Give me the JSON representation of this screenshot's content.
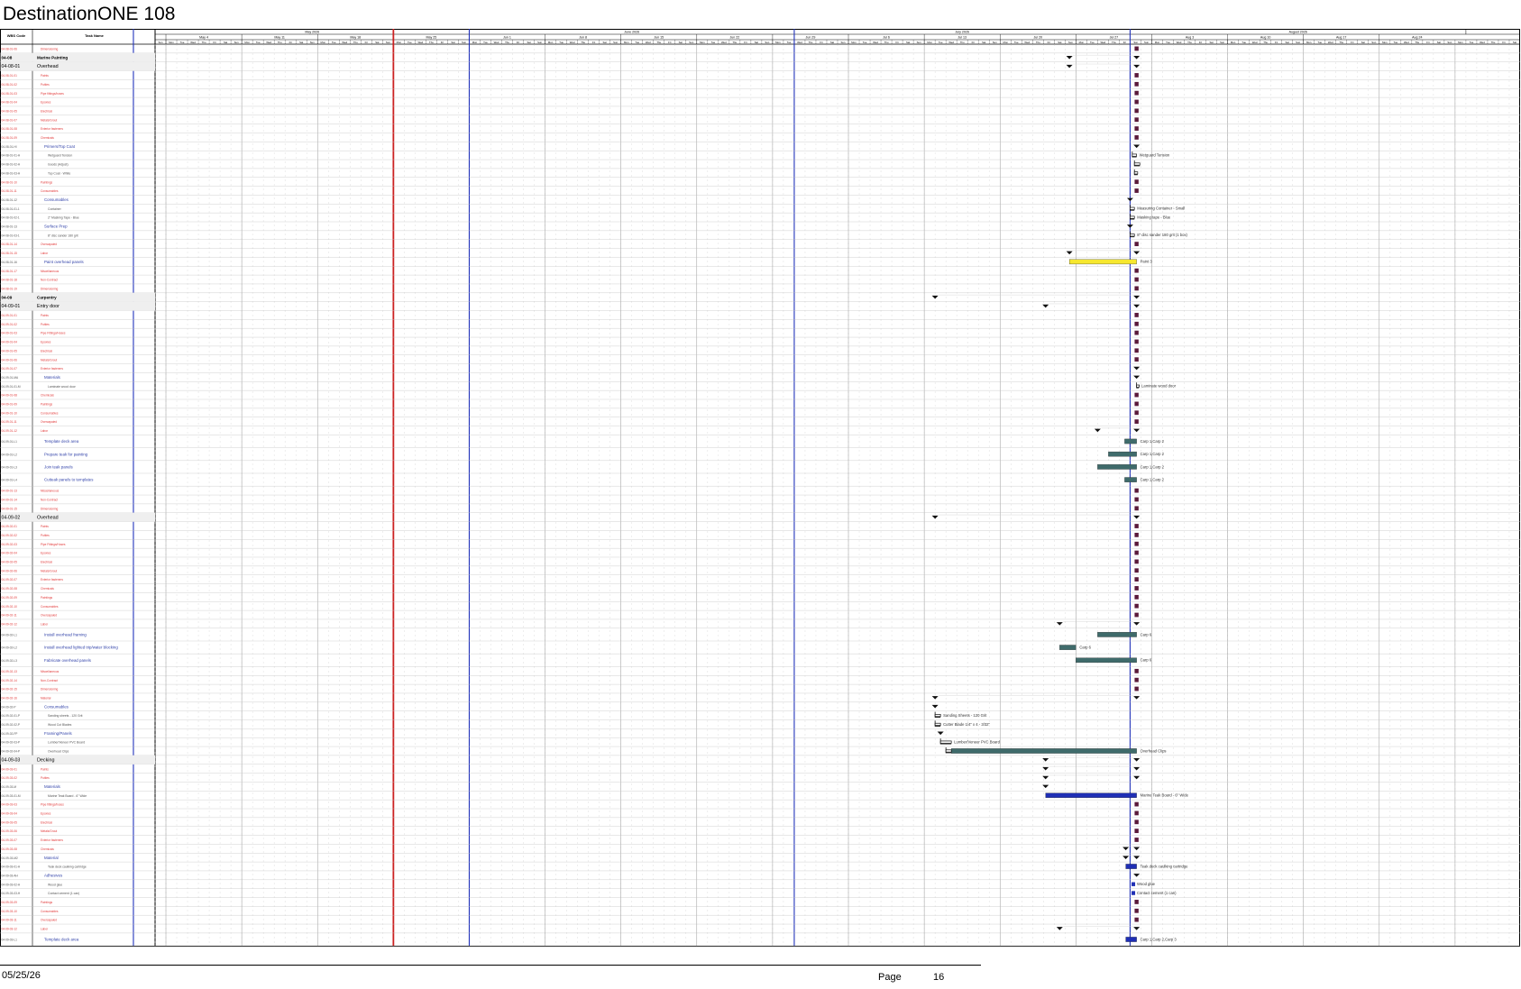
{
  "document": {
    "title": "DestinationONE 108"
  },
  "columns": {
    "wbs": "WBS Code",
    "task": "Task Name"
  },
  "months": [
    {
      "label": "May 2026",
      "start": 0,
      "days": 31
    },
    {
      "label": "June 2026",
      "start": 31,
      "days": 30
    },
    {
      "label": "July 2026",
      "start": 61,
      "days": 31
    },
    {
      "label": "August 2026",
      "start": 92,
      "days": 31
    }
  ],
  "weeks": [
    "May 4",
    "May 11",
    "May 18",
    "May 25",
    "Jun 1",
    "Jun 8",
    "Jun 15",
    "Jun 22",
    "Jun 29",
    "Jul 6",
    "Jul 13",
    "Jul 20",
    "Jul 27",
    "Aug 3",
    "Aug 10",
    "Aug 17",
    "Aug 24"
  ],
  "weekdays": [
    "Mon",
    "Tue",
    "Wed",
    "Thu",
    "Fri",
    "Sat",
    "Sun"
  ],
  "today_marker": "May 25",
  "rows": [
    {
      "wbs": "04-08-01-06",
      "name": "Dimensioning",
      "type": "res",
      "indent": 1,
      "ms": [
        92.6
      ]
    },
    {
      "wbs": "04-08",
      "name": "Marine Painting",
      "type": "phase",
      "indent": 0,
      "tri": [
        86.4,
        92.6
      ]
    },
    {
      "wbs": "04-08-01",
      "name": "Overhead",
      "type": "group",
      "indent": 0,
      "tri": [
        86.4,
        92.6
      ]
    },
    {
      "wbs": "04-08-01-01",
      "name": "Paints",
      "type": "res",
      "indent": 1,
      "ms": [
        92.6
      ]
    },
    {
      "wbs": "04-08-01-02",
      "name": "Putties",
      "type": "res",
      "indent": 1,
      "ms": [
        92.6
      ]
    },
    {
      "wbs": "04-08-01-03",
      "name": "Pipe fittings/hoses",
      "type": "res",
      "indent": 1,
      "ms": [
        92.6
      ]
    },
    {
      "wbs": "04-08-01-04",
      "name": "Epoxies",
      "type": "res",
      "indent": 1,
      "ms": [
        92.6
      ]
    },
    {
      "wbs": "04-08-01-05",
      "name": "Electrical",
      "type": "res",
      "indent": 1,
      "ms": [
        92.6
      ]
    },
    {
      "wbs": "04-08-01-07",
      "name": "Metals/Grout",
      "type": "res",
      "indent": 1,
      "ms": [
        92.6
      ]
    },
    {
      "wbs": "04-08-01-08",
      "name": "Exterior fasteners",
      "type": "res",
      "indent": 1,
      "ms": [
        92.6
      ]
    },
    {
      "wbs": "04-08-01-09",
      "name": "Chemicals",
      "type": "res",
      "indent": 1,
      "ms": [
        92.6
      ]
    },
    {
      "wbs": "04-08-01-HI",
      "name": "Primers/Top Coat",
      "type": "sub",
      "indent": 2,
      "tri": [
        92.6
      ]
    },
    {
      "wbs": "04-08-01-01-H",
      "name": "Wetguard Tension",
      "type": "item",
      "indent": 3,
      "brk": [
        92.2,
        92.6
      ],
      "lbl": "Wetguard Tension"
    },
    {
      "wbs": "04-08-01-02-H",
      "name": "Goods (Adjust)",
      "type": "item",
      "indent": 3,
      "brk": [
        92.4,
        92.9
      ]
    },
    {
      "wbs": "04-08-01-03-H",
      "name": "Top Coat - White",
      "type": "item",
      "indent": 3,
      "brk": [
        92.4,
        92.7
      ]
    },
    {
      "wbs": "04-08-01-10",
      "name": "Paintings",
      "type": "res",
      "indent": 1,
      "ms": [
        92.6
      ]
    },
    {
      "wbs": "04-08-01-11",
      "name": "Consumables",
      "type": "res",
      "indent": 1,
      "ms": [
        92.6
      ]
    },
    {
      "wbs": "04-08-01-12",
      "name": "Consumables",
      "type": "sub",
      "indent": 2,
      "tri": [
        92.0
      ]
    },
    {
      "wbs": "04-08-01-01-1",
      "name": "Container",
      "type": "item",
      "indent": 3,
      "brk": [
        92.0,
        92.4
      ],
      "lbl": "Measuring Container - Small"
    },
    {
      "wbs": "04-08-01-02-1",
      "name": "2\" Masking Tape - Blue",
      "type": "item",
      "indent": 3,
      "brk": [
        92.0,
        92.4
      ],
      "lbl": "Masking tape - Blue"
    },
    {
      "wbs": "04-08-01-13",
      "name": "Surface Prep",
      "type": "sub",
      "indent": 2,
      "tri": [
        92.0
      ]
    },
    {
      "wbs": "04-08-01-03-1",
      "name": "8\" disc sander 180 grit",
      "type": "item",
      "indent": 3,
      "brk": [
        92.0,
        92.4
      ],
      "lbl": "8\" disc sander 180 grit (1 box)"
    },
    {
      "wbs": "04-08-01-14",
      "name": "Overcapaied",
      "type": "res",
      "indent": 1,
      "ms": [
        92.6
      ]
    },
    {
      "wbs": "04-08-01-15",
      "name": "Labor",
      "type": "res",
      "indent": 1,
      "tri": [
        86.4,
        92.6
      ]
    },
    {
      "wbs": "04-08-01-16",
      "name": "Paint overhead panels",
      "type": "task",
      "indent": 2,
      "bar": [
        86.4,
        92.6,
        "#f6e72f"
      ],
      "lbl": "Paint 3"
    },
    {
      "wbs": "04-08-01-17",
      "name": "Miscellaneous",
      "type": "res",
      "indent": 1,
      "ms": [
        92.6
      ]
    },
    {
      "wbs": "04-08-01-18",
      "name": "Non-Contract",
      "type": "res",
      "indent": 1,
      "ms": [
        92.6
      ]
    },
    {
      "wbs": "04-08-01-19",
      "name": "Dimensioning",
      "type": "res",
      "indent": 1,
      "ms": [
        92.6
      ]
    },
    {
      "wbs": "04-09",
      "name": "Carpentry",
      "type": "phase",
      "indent": 0,
      "tri": [
        74.0,
        92.6
      ]
    },
    {
      "wbs": "04-09-01",
      "name": "Entry door",
      "type": "group",
      "indent": 0,
      "tri": [
        84.2,
        92.6
      ]
    },
    {
      "wbs": "04-09-01-01",
      "name": "Paints",
      "type": "res",
      "indent": 1,
      "ms": [
        92.6
      ]
    },
    {
      "wbs": "04-09-01-02",
      "name": "Putties",
      "type": "res",
      "indent": 1,
      "ms": [
        92.6
      ]
    },
    {
      "wbs": "04-09-01-03",
      "name": "Pipe Fittings/Hoses",
      "type": "res",
      "indent": 1,
      "ms": [
        92.6
      ]
    },
    {
      "wbs": "04-09-01-04",
      "name": "Epoxies",
      "type": "res",
      "indent": 1,
      "ms": [
        92.6
      ]
    },
    {
      "wbs": "04-09-01-05",
      "name": "Electrical",
      "type": "res",
      "indent": 1,
      "ms": [
        92.6
      ]
    },
    {
      "wbs": "04-09-01-06",
      "name": "Metals/Grout",
      "type": "res",
      "indent": 1,
      "ms": [
        92.6
      ]
    },
    {
      "wbs": "04-09-01-07",
      "name": "Exterior fasteners",
      "type": "res",
      "indent": 1,
      "tri": [
        92.6
      ]
    },
    {
      "wbs": "04-09-01-MA",
      "name": "Materials",
      "type": "sub",
      "indent": 2,
      "tri": [
        92.6
      ]
    },
    {
      "wbs": "04-09-01-01-M",
      "name": "Laminate wood door",
      "type": "item",
      "indent": 3,
      "brk": [
        92.6,
        92.8
      ],
      "lbl": "Laminate wood door"
    },
    {
      "wbs": "04-09-01-08",
      "name": "Chemicals",
      "type": "res",
      "indent": 1,
      "ms": [
        92.6
      ]
    },
    {
      "wbs": "04-09-01-09",
      "name": "Paintings",
      "type": "res",
      "indent": 1,
      "ms": [
        92.6
      ]
    },
    {
      "wbs": "04-09-01-10",
      "name": "Consumables",
      "type": "res",
      "indent": 1,
      "ms": [
        92.6
      ]
    },
    {
      "wbs": "04-09-01-11",
      "name": "Overcapaied",
      "type": "res",
      "indent": 1,
      "ms": [
        92.6
      ]
    },
    {
      "wbs": "04-09-01-12",
      "name": "Labor",
      "type": "res",
      "indent": 1,
      "tri": [
        89.0,
        92.6
      ]
    },
    {
      "wbs": "04-09-01-L1",
      "name": "Template deck area",
      "type": "task",
      "indent": 2,
      "tall": true,
      "bar": [
        91.5,
        92.6,
        "#3f6b6b"
      ],
      "lbl": "Carp 1,Carp 2"
    },
    {
      "wbs": "04-09-01-L2",
      "name": "Prepare teak for painting",
      "type": "task",
      "indent": 2,
      "tall": true,
      "bar": [
        90.0,
        92.6,
        "#3f6b6b"
      ],
      "lbl": "Carp 1,Carp 2"
    },
    {
      "wbs": "04-09-01-L3",
      "name": "Join teak panels",
      "type": "task",
      "indent": 2,
      "tall": true,
      "bar": [
        89.0,
        92.6,
        "#3f6b6b"
      ],
      "lbl": "Carp 1,Carp 2"
    },
    {
      "wbs": "04-09-01-L4",
      "name": "Cutteak panels to templates",
      "type": "task",
      "indent": 2,
      "tall": true,
      "bar": [
        91.5,
        92.6,
        "#3f6b6b"
      ],
      "lbl": "Carp 1,Carp 2"
    },
    {
      "wbs": "04-09-01-13",
      "name": "Miscellaneous",
      "type": "res",
      "indent": 1,
      "ms": [
        92.6
      ]
    },
    {
      "wbs": "04-09-01-14",
      "name": "Non-Contract",
      "type": "res",
      "indent": 1,
      "ms": [
        92.6
      ]
    },
    {
      "wbs": "04-09-01-15",
      "name": "Dimensioning",
      "type": "res",
      "indent": 1,
      "ms": [
        92.6
      ]
    },
    {
      "wbs": "04-09-02",
      "name": "Overhead",
      "type": "group",
      "indent": 0,
      "tri": [
        74.0,
        92.6
      ]
    },
    {
      "wbs": "04-09-02-01",
      "name": "Paints",
      "type": "res",
      "indent": 1,
      "ms": [
        92.6
      ]
    },
    {
      "wbs": "04-09-02-02",
      "name": "Putties",
      "type": "res",
      "indent": 1,
      "ms": [
        92.6
      ]
    },
    {
      "wbs": "04-09-02-03",
      "name": "Pipe Fittings/Hoses",
      "type": "res",
      "indent": 1,
      "ms": [
        92.6
      ]
    },
    {
      "wbs": "04-09-02-04",
      "name": "Epoxies",
      "type": "res",
      "indent": 1,
      "ms": [
        92.6
      ]
    },
    {
      "wbs": "04-09-02-05",
      "name": "Electrical",
      "type": "res",
      "indent": 1,
      "ms": [
        92.6
      ]
    },
    {
      "wbs": "04-09-02-06",
      "name": "Metals/Grout",
      "type": "res",
      "indent": 1,
      "ms": [
        92.6
      ]
    },
    {
      "wbs": "04-09-02-07",
      "name": "Exterior fasteners",
      "type": "res",
      "indent": 1,
      "ms": [
        92.6
      ]
    },
    {
      "wbs": "04-09-02-08",
      "name": "Chemicals",
      "type": "res",
      "indent": 1,
      "ms": [
        92.6
      ]
    },
    {
      "wbs": "04-09-02-09",
      "name": "Paintings",
      "type": "res",
      "indent": 1,
      "ms": [
        92.6
      ]
    },
    {
      "wbs": "04-09-02-10",
      "name": "Consumables",
      "type": "res",
      "indent": 1,
      "ms": [
        92.6
      ]
    },
    {
      "wbs": "04-09-02-11",
      "name": "Overcapaied",
      "type": "res",
      "indent": 1,
      "ms": [
        92.6
      ]
    },
    {
      "wbs": "04-09-02-12",
      "name": "Labor",
      "type": "res",
      "indent": 1,
      "tri": [
        85.5,
        92.6
      ]
    },
    {
      "wbs": "04-09-02-L1",
      "name": "Install overhead framing",
      "type": "task",
      "indent": 2,
      "tall": true,
      "bar": [
        89.0,
        92.6,
        "#3f6b6b"
      ],
      "lbl": "Carp 6"
    },
    {
      "wbs": "04-09-02-L2",
      "name": "Install overhead lighted trip/water blocking",
      "type": "task",
      "indent": 2,
      "tall": true,
      "bar": [
        85.5,
        87.0,
        "#3f6b6b"
      ],
      "lbl": "Carp 6"
    },
    {
      "wbs": "04-09-02-L3",
      "name": "Fabricate overhead panels",
      "type": "task",
      "indent": 2,
      "tall": true,
      "bar": [
        87.0,
        92.6,
        "#3f6b6b"
      ],
      "lbl": "Carp 6"
    },
    {
      "wbs": "04-09-02-13",
      "name": "Miscellaneous",
      "type": "res",
      "indent": 1,
      "ms": [
        92.6
      ]
    },
    {
      "wbs": "04-09-02-14",
      "name": "Non-Contract",
      "type": "res",
      "indent": 1,
      "ms": [
        92.6
      ]
    },
    {
      "wbs": "04-09-02-15",
      "name": "Dimensioning",
      "type": "res",
      "indent": 1,
      "ms": [
        92.6
      ]
    },
    {
      "wbs": "04-09-02-16",
      "name": "Material",
      "type": "res",
      "indent": 1,
      "tri": [
        74.0,
        92.6
      ]
    },
    {
      "wbs": "04-09-02-P",
      "name": "Consumables",
      "type": "sub",
      "indent": 2,
      "tri": [
        74.0
      ]
    },
    {
      "wbs": "04-09-02-01-P",
      "name": "Sanding sheets - 120 Grit",
      "type": "item",
      "indent": 3,
      "brk": [
        74.0,
        74.5
      ],
      "lbl": "Sanding Sheets - 120 Grit"
    },
    {
      "wbs": "04-09-02-02-P",
      "name": "Wood Cut Blades",
      "type": "item",
      "indent": 3,
      "brk": [
        74.0,
        74.5
      ],
      "lbl": "Cutter Blade 1/4\" x 4 - 3/32\""
    },
    {
      "wbs": "04-09-02-FP",
      "name": "Framing/Panels",
      "type": "sub",
      "indent": 2,
      "tri": [
        74.5
      ]
    },
    {
      "wbs": "04-09-02-03-P",
      "name": "Lumber/Veneer PVC Board",
      "type": "item",
      "indent": 3,
      "brk": [
        74.5,
        75.5
      ],
      "lbl": "Lumber/Veneer PVC Board"
    },
    {
      "wbs": "04-09-02-04-P",
      "name": "Overhead Clips",
      "type": "item",
      "indent": 3,
      "bar": [
        75.5,
        92.6,
        "#3f6b6b"
      ],
      "brk": [
        75.0,
        75.5
      ],
      "lbl": "Overhead Clips"
    },
    {
      "wbs": "04-09-03",
      "name": "Decking",
      "type": "group",
      "indent": 0,
      "tri": [
        84.2,
        92.6
      ]
    },
    {
      "wbs": "04-09-03-01",
      "name": "Paints",
      "type": "res",
      "indent": 1,
      "tri": [
        84.2,
        92.6
      ]
    },
    {
      "wbs": "04-09-03-02",
      "name": "Putties",
      "type": "res",
      "indent": 1,
      "tri": [
        84.2,
        92.6
      ]
    },
    {
      "wbs": "04-09-03-M",
      "name": "Materials",
      "type": "sub",
      "indent": 2,
      "tri": [
        84.2
      ]
    },
    {
      "wbs": "04-09-03-01-M",
      "name": "Marine Teak Board - 6\" Wide",
      "type": "item",
      "indent": 3,
      "bar": [
        84.2,
        92.6,
        "#1f2fb5"
      ],
      "lbl": "Marine Teak Board - 6\" Wide"
    },
    {
      "wbs": "04-09-03-03",
      "name": "Pipe fittings/hoses",
      "type": "res",
      "indent": 1,
      "ms": [
        92.6
      ]
    },
    {
      "wbs": "04-09-03-04",
      "name": "Epoxies",
      "type": "res",
      "indent": 1,
      "ms": [
        92.6
      ]
    },
    {
      "wbs": "04-09-03-05",
      "name": "Electrical",
      "type": "res",
      "indent": 1,
      "ms": [
        92.6
      ]
    },
    {
      "wbs": "04-09-03-06",
      "name": "Metals/Grout",
      "type": "res",
      "indent": 1,
      "ms": [
        92.6
      ]
    },
    {
      "wbs": "04-09-03-07",
      "name": "Exterior fasteners",
      "type": "res",
      "indent": 1,
      "ms": [
        92.6
      ]
    },
    {
      "wbs": "04-09-03-08",
      "name": "Chemicals",
      "type": "res",
      "indent": 1,
      "tri": [
        91.6,
        92.6
      ]
    },
    {
      "wbs": "04-09-03-M2",
      "name": "Material",
      "type": "sub",
      "indent": 2,
      "tri": [
        91.6,
        92.6
      ]
    },
    {
      "wbs": "04-09-03-01-H",
      "name": "Teak deck caulking cartridge",
      "type": "item",
      "indent": 3,
      "bar": [
        91.6,
        92.6,
        "#1f2fb5"
      ],
      "lbl": "Teak deck caulking cartridge"
    },
    {
      "wbs": "04-09-03-AH",
      "name": "Adhesives",
      "type": "sub",
      "indent": 2,
      "tri": [
        92.6
      ]
    },
    {
      "wbs": "04-09-03-02-H",
      "name": "Wood glue",
      "type": "item",
      "indent": 3,
      "ms2": [
        92.3
      ],
      "lbl": "Wood glue"
    },
    {
      "wbs": "04-09-03-03-H",
      "name": "Contact cement (1 can)",
      "type": "item",
      "indent": 3,
      "ms2": [
        92.3
      ],
      "lbl": "Contact cement (1 can)"
    },
    {
      "wbs": "04-09-03-09",
      "name": "Paintings",
      "type": "res",
      "indent": 1,
      "ms": [
        92.6
      ]
    },
    {
      "wbs": "04-09-03-10",
      "name": "Consumables",
      "type": "res",
      "indent": 1,
      "ms": [
        92.6
      ]
    },
    {
      "wbs": "04-09-03-11",
      "name": "Overcapaied",
      "type": "res",
      "indent": 1,
      "ms": [
        92.6
      ]
    },
    {
      "wbs": "04-09-03-12",
      "name": "Labor",
      "type": "res",
      "indent": 1,
      "tri": [
        85.5,
        92.6
      ]
    },
    {
      "wbs": "04-09-03-L1",
      "name": "Template deck area",
      "type": "task",
      "indent": 2,
      "tall": true,
      "bar": [
        91.6,
        92.6,
        "#1f2fb5"
      ],
      "lbl": "Carp 1,Carp 2,Carp 3"
    }
  ],
  "footer": {
    "date": "05/25/26",
    "page_label": "Page",
    "page_number": "16"
  },
  "colors": {
    "res_text": "#e23a3a",
    "task_text": "#3344aa",
    "week_line": "#2233bb",
    "today_line": "#cc2222",
    "milestone": "#5a1a3a"
  }
}
